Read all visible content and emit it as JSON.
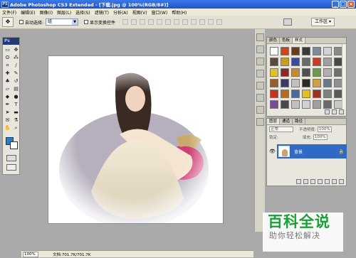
{
  "titlebar": {
    "app_title": "Adobe Photoshop CS3 Extended - [下载.jpg @ 100%(RGB/8#)]",
    "logo": "PS"
  },
  "menubar": {
    "items": [
      "文件(F)",
      "编辑(E)",
      "图像(I)",
      "图层(L)",
      "选择(S)",
      "滤镜(T)",
      "分析(A)",
      "视图(V)",
      "窗口(W)",
      "帮助(H)"
    ]
  },
  "options": {
    "auto_select_label": "自动选择:",
    "auto_select_value": "组",
    "show_transform_label": "显示变换控件",
    "workspace_label": "工作区 ▾"
  },
  "toolbox": {
    "logo": "Ps",
    "tools": [
      {
        "icon": "marquee-icon",
        "glyph": "▭"
      },
      {
        "icon": "move-icon",
        "glyph": "✥"
      },
      {
        "icon": "lasso-icon",
        "glyph": "ʘ"
      },
      {
        "icon": "magic-wand-icon",
        "glyph": "⁂"
      },
      {
        "icon": "crop-icon",
        "glyph": "⌗"
      },
      {
        "icon": "slice-icon",
        "glyph": "∕"
      },
      {
        "icon": "healing-brush-icon",
        "glyph": "✚"
      },
      {
        "icon": "brush-icon",
        "glyph": "✎"
      },
      {
        "icon": "clone-stamp-icon",
        "glyph": "♣"
      },
      {
        "icon": "history-brush-icon",
        "glyph": "↺"
      },
      {
        "icon": "eraser-icon",
        "glyph": "▱"
      },
      {
        "icon": "gradient-icon",
        "glyph": "▤"
      },
      {
        "icon": "blur-icon",
        "glyph": "◆"
      },
      {
        "icon": "dodge-icon",
        "glyph": "●"
      },
      {
        "icon": "pen-icon",
        "glyph": "✒"
      },
      {
        "icon": "type-icon",
        "glyph": "T"
      },
      {
        "icon": "path-select-icon",
        "glyph": "➤"
      },
      {
        "icon": "shape-icon",
        "glyph": "▬"
      },
      {
        "icon": "notes-icon",
        "glyph": "✉"
      },
      {
        "icon": "eyedropper-icon",
        "glyph": "⚗"
      },
      {
        "icon": "hand-icon",
        "glyph": "✋"
      },
      {
        "icon": "zoom-icon",
        "glyph": "⌕"
      }
    ],
    "fg_color": "#1e7fd4",
    "bg_color": "#ffffff"
  },
  "panels": {
    "styles_tabs": [
      "颜色",
      "色板",
      "样式"
    ],
    "styles_active_tab": "样式",
    "style_swatches": [
      "#ffffff",
      "#c8451c",
      "#6a3a1a",
      "#3a3a3a",
      "#7a8a98",
      "#d2d2d2",
      "#8a8a8a",
      "#5a4a3a",
      "#c8a020",
      "#3a4aa0",
      "#6a6a6a",
      "#c83a2a",
      "#a0a0a0",
      "#4a4a4a",
      "#e0c030",
      "#8a2a2a",
      "#c88a30",
      "#505050",
      "#6a9a4a",
      "#b0b0b0",
      "#707070",
      "#9a5a2a",
      "#3a3a6a",
      "#c0c0c0",
      "#2a2a2a",
      "#d0a040",
      "#6a7a8a",
      "#909090",
      "#c83020",
      "#b07020",
      "#4a6aa0",
      "#e0c020",
      "#a03020",
      "#808080",
      "#5a5a5a",
      "#7a4a9a",
      "#4a4a4a",
      "#c0c0c0",
      "#d0d0d0",
      "#a0a0a0",
      "#6a6a6a",
      "#c8c8c8"
    ],
    "layers_tabs": [
      "图层",
      "通道",
      "路径"
    ],
    "layers_active_tab": "图层",
    "blend_mode": "正常",
    "opacity_label": "不透明度:",
    "opacity_value": "100%",
    "lock_label": "锁定:",
    "fill_label": "填充:",
    "fill_value": "100%",
    "layer_name": "背景"
  },
  "status": {
    "zoom": "100%",
    "doc_info": "文档:701.7K/701.7K"
  },
  "watermark": {
    "title": "百科全说",
    "subtitle": "助你轻松解决"
  }
}
